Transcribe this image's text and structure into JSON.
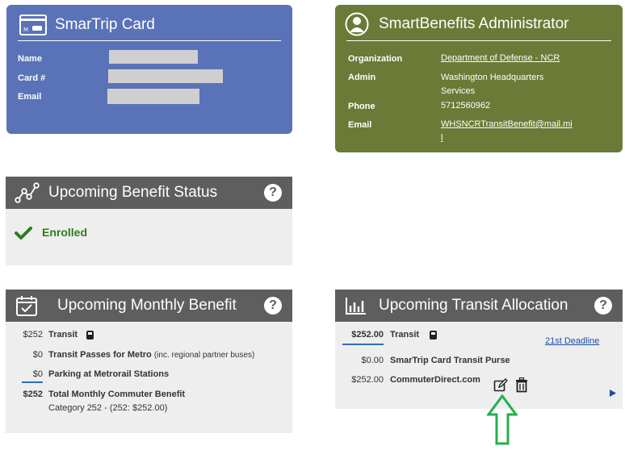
{
  "smartrip": {
    "title": "SmarTrip Card",
    "fields": [
      {
        "label": "Name"
      },
      {
        "label": "Card #"
      },
      {
        "label": "Email"
      }
    ]
  },
  "admin": {
    "title": "SmartBenefits Administrator",
    "organization_label": "Organization",
    "organization_value": "Department of Defense - NCR",
    "admin_label": "Admin",
    "admin_value_line1": "Washington Headquarters",
    "admin_value_line2": "Services",
    "phone_label": "Phone",
    "phone_value": "5712560962",
    "email_label": "Email",
    "email_value_line1": "WHSNCRTransitBenefit@mail.mi",
    "email_value_line2": "l"
  },
  "status": {
    "title": "Upcoming Benefit Status",
    "help": "?",
    "state": "Enrolled"
  },
  "monthly": {
    "title": "Upcoming Monthly Benefit",
    "help": "?",
    "rows": [
      {
        "amount": "$252",
        "label": "Transit"
      },
      {
        "amount": "$0",
        "label": "Transit Passes for Metro",
        "note": "(inc. regional partner buses)"
      },
      {
        "amount": "$0",
        "label": "Parking at Metrorail Stations"
      }
    ],
    "total_amount": "$252",
    "total_label": "Total Monthly Commuter Benefit",
    "category": "Category 252 - (252: $252.00)"
  },
  "alloc": {
    "title": "Upcoming Transit Allocation",
    "help": "?",
    "transit_amount": "$252.00",
    "transit_label": "Transit",
    "deadline_link": "21st Deadline",
    "purse_amount": "$0.00",
    "purse_label": "SmarTrip Card Transit Purse",
    "cd_amount": "$252.00",
    "cd_label": "CommuterDirect.com"
  },
  "colors": {
    "smartrip_bg": "#5a73b8",
    "admin_bg": "#6b7a37",
    "panel_header": "#5e5e5e",
    "enrolled_green": "#2e7d1a",
    "annotation_arrow": "#22b14c"
  }
}
